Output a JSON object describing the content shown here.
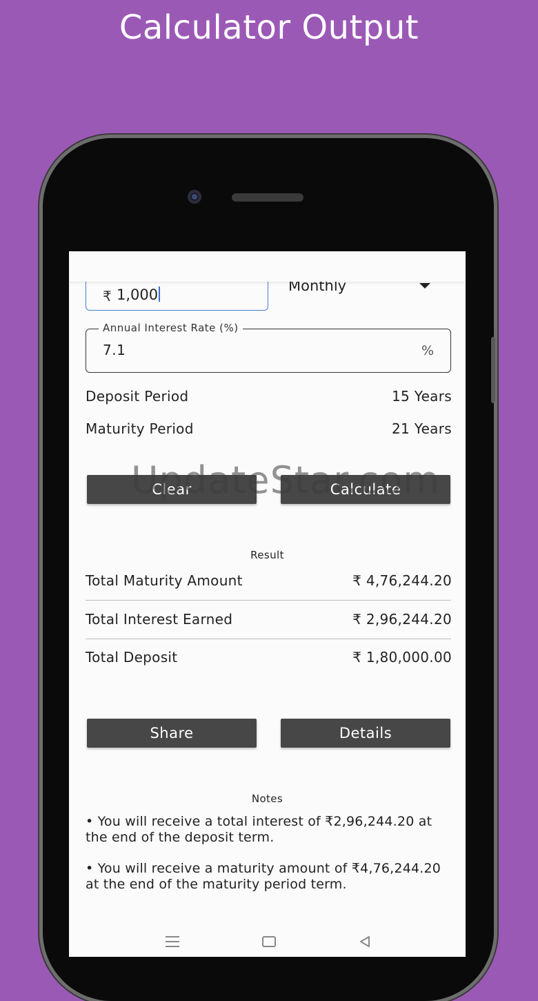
{
  "headline": "Calculator Output",
  "form": {
    "currency_symbol": "₹",
    "deposit_amount": "1,000",
    "frequency": "Monthly",
    "rate_label": "Annual Interest Rate (%)",
    "rate_value": "7.1",
    "rate_suffix": "%"
  },
  "periods": {
    "deposit_label": "Deposit Period",
    "deposit_value": "15 Years",
    "maturity_label": "Maturity Period",
    "maturity_value": "21 Years"
  },
  "actions": {
    "clear": "Clear",
    "calculate": "Calculate",
    "share": "Share",
    "details": "Details"
  },
  "watermark": "UpdateStar.com",
  "result": {
    "title": "Result",
    "rows": [
      {
        "label": "Total Maturity Amount",
        "value": "₹ 4,76,244.20"
      },
      {
        "label": "Total Interest Earned",
        "value": "₹ 2,96,244.20"
      },
      {
        "label": "Total Deposit",
        "value": "₹ 1,80,000.00"
      }
    ]
  },
  "notes": {
    "title": "Notes",
    "items": [
      "• You will receive a total interest of ₹2,96,244.20 at the end of the deposit term.",
      "• You will receive a maturity amount of ₹4,76,244.20 at the end of the maturity period term."
    ]
  },
  "icons": {
    "menu": "menu-icon",
    "home": "home-icon",
    "back": "back-icon",
    "dropdown": "chevron-down-icon"
  },
  "colors": {
    "background": "#9b59b6",
    "button": "#474747",
    "focus": "#4a7bd0"
  }
}
